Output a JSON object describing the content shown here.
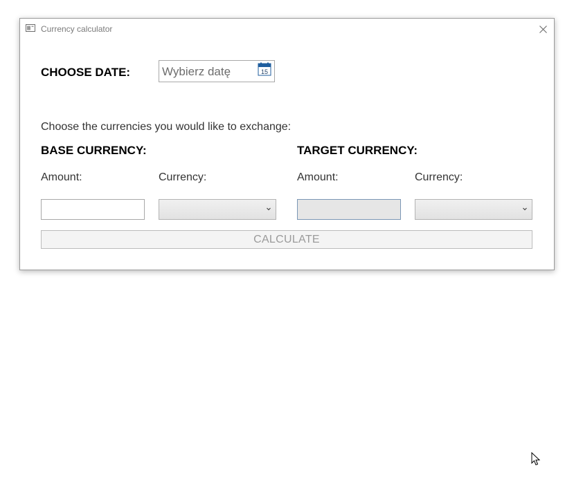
{
  "window": {
    "title": "Currency calculator"
  },
  "date": {
    "label": "CHOOSE DATE:",
    "placeholder": "Wybierz datę",
    "calendar_day": "15"
  },
  "instructions": "Choose the currencies you would like to exchange:",
  "base": {
    "heading": "BASE CURRENCY:",
    "amount_label": "Amount:",
    "currency_label": "Currency:",
    "amount_value": "",
    "currency_value": ""
  },
  "target": {
    "heading": "TARGET CURRENCY:",
    "amount_label": "Amount:",
    "currency_label": "Currency:",
    "amount_value": "",
    "currency_value": ""
  },
  "calculate_label": "CALCULATE",
  "colors": {
    "calendar_icon": "#1f5e9e",
    "disabled_border": "#7a96b5"
  }
}
